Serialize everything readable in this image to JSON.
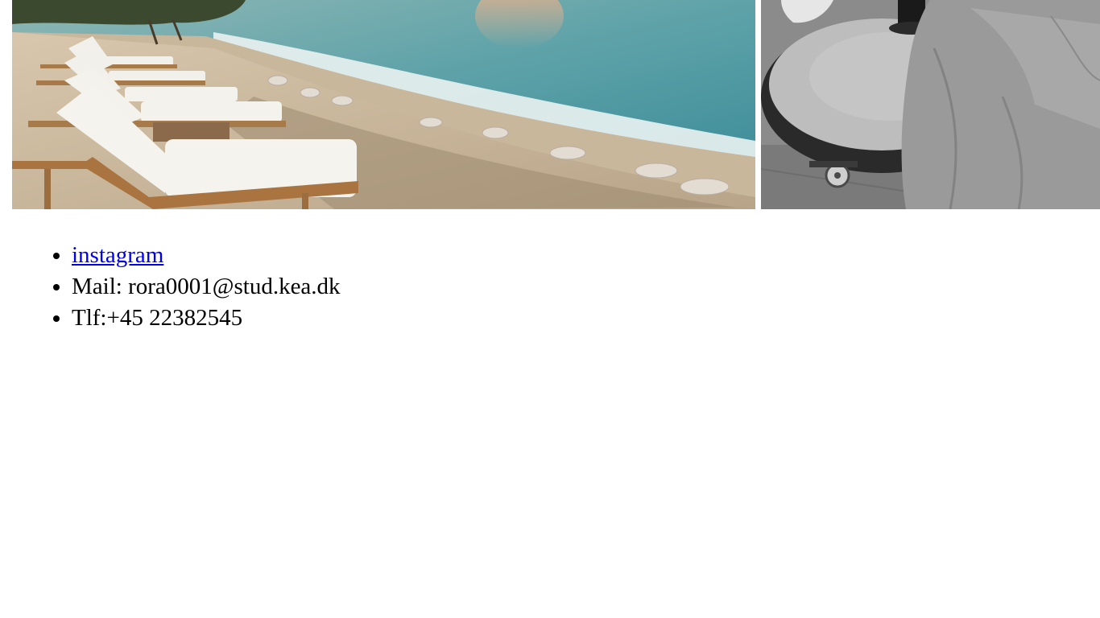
{
  "gallery": {
    "images": [
      {
        "subject": "beach",
        "description_icon": "photo-icon"
      },
      {
        "subject": "table-umbrella-base",
        "description_icon": "photo-icon"
      }
    ]
  },
  "contact": {
    "instagram_label": "instagram",
    "mail_label": "Mail: rora0001@stud.kea.dk",
    "phone_label": "Tlf:+45 22382545"
  },
  "colors": {
    "link": "#0000ee",
    "text": "#000000",
    "background": "#ffffff"
  }
}
